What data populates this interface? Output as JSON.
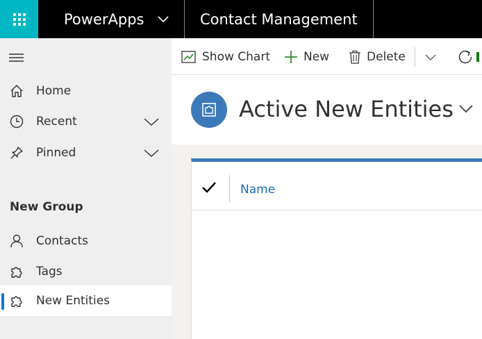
{
  "topbar": {
    "app_name": "PowerApps",
    "app_title": "Contact Management",
    "waffle_color": "#00b7c3"
  },
  "sidebar": {
    "items": [
      {
        "label": "Home",
        "icon": "home-icon"
      },
      {
        "label": "Recent",
        "icon": "clock-icon"
      },
      {
        "label": "Pinned",
        "icon": "pin-icon"
      }
    ],
    "group_title": "New Group",
    "group_items": [
      {
        "label": "Contacts",
        "icon": "person-icon"
      },
      {
        "label": "Tags",
        "icon": "puzzle-icon"
      },
      {
        "label": "New Entities",
        "icon": "puzzle-icon",
        "selected": true
      }
    ]
  },
  "commandbar": {
    "show_chart": "Show Chart",
    "new": "New",
    "delete": "Delete"
  },
  "main": {
    "title": "Active New Entities",
    "accent_color": "#3b79b9",
    "grid": {
      "columns": [
        "Name"
      ]
    }
  }
}
